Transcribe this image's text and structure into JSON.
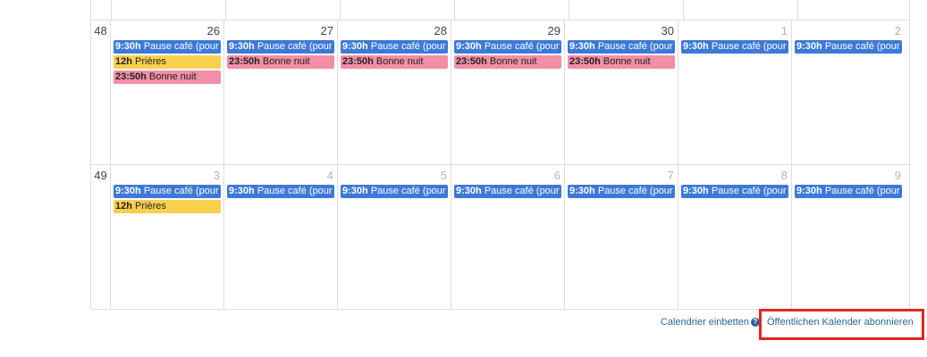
{
  "weeks": [
    {
      "number": "48",
      "days": [
        {
          "num": "26",
          "other": false,
          "events": [
            {
              "time": "9:30h",
              "title": "Pause café (pour",
              "color": "blue"
            },
            {
              "time": "12h",
              "title": "Prières",
              "color": "yellow"
            },
            {
              "time": "23:50h",
              "title": "Bonne nuit",
              "color": "pink"
            }
          ]
        },
        {
          "num": "27",
          "other": false,
          "events": [
            {
              "time": "9:30h",
              "title": "Pause café (pour",
              "color": "blue"
            },
            {
              "time": "23:50h",
              "title": "Bonne nuit",
              "color": "pink"
            }
          ]
        },
        {
          "num": "28",
          "other": false,
          "events": [
            {
              "time": "9:30h",
              "title": "Pause café (pour",
              "color": "blue"
            },
            {
              "time": "23:50h",
              "title": "Bonne nuit",
              "color": "pink"
            }
          ]
        },
        {
          "num": "29",
          "other": false,
          "events": [
            {
              "time": "9:30h",
              "title": "Pause café (pour",
              "color": "blue"
            },
            {
              "time": "23:50h",
              "title": "Bonne nuit",
              "color": "pink"
            }
          ]
        },
        {
          "num": "30",
          "other": false,
          "events": [
            {
              "time": "9:30h",
              "title": "Pause café (pour",
              "color": "blue"
            },
            {
              "time": "23:50h",
              "title": "Bonne nuit",
              "color": "pink"
            }
          ]
        },
        {
          "num": "1",
          "other": true,
          "events": [
            {
              "time": "9:30h",
              "title": "Pause café (pour",
              "color": "blue"
            }
          ]
        },
        {
          "num": "2",
          "other": true,
          "events": [
            {
              "time": "9:30h",
              "title": "Pause café (pour",
              "color": "blue"
            }
          ]
        }
      ]
    },
    {
      "number": "49",
      "days": [
        {
          "num": "3",
          "other": true,
          "events": [
            {
              "time": "9:30h",
              "title": "Pause café (pour",
              "color": "blue"
            },
            {
              "time": "12h",
              "title": "Prières",
              "color": "yellow"
            }
          ]
        },
        {
          "num": "4",
          "other": true,
          "events": [
            {
              "time": "9:30h",
              "title": "Pause café (pour",
              "color": "blue"
            }
          ]
        },
        {
          "num": "5",
          "other": true,
          "events": [
            {
              "time": "9:30h",
              "title": "Pause café (pour",
              "color": "blue"
            }
          ]
        },
        {
          "num": "6",
          "other": true,
          "events": [
            {
              "time": "9:30h",
              "title": "Pause café (pour",
              "color": "blue"
            }
          ]
        },
        {
          "num": "7",
          "other": true,
          "events": [
            {
              "time": "9:30h",
              "title": "Pause café (pour",
              "color": "blue"
            }
          ]
        },
        {
          "num": "8",
          "other": true,
          "events": [
            {
              "time": "9:30h",
              "title": "Pause café (pour",
              "color": "blue"
            }
          ]
        },
        {
          "num": "9",
          "other": true,
          "events": [
            {
              "time": "9:30h",
              "title": "Pause café (pour",
              "color": "blue"
            }
          ]
        }
      ]
    }
  ],
  "footer": {
    "embed_label": "Calendrier einbetten",
    "help_icon": "question-circle-icon",
    "help_glyph": "?",
    "subscribe_label": "Öffentlichen Kalender abonnieren"
  },
  "colors": {
    "blue": "#3d79d8",
    "yellow": "#f9d04e",
    "pink": "#f28ea6",
    "highlight": "#e0251f",
    "link": "#2a6496"
  }
}
